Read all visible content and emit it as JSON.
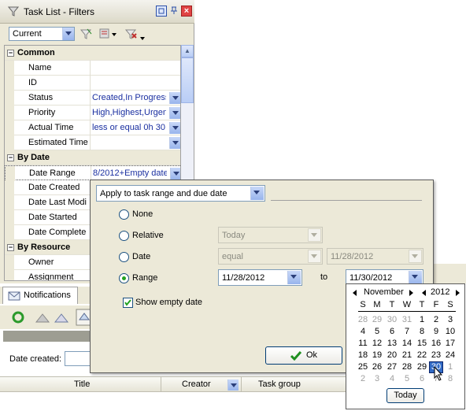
{
  "window": {
    "title": "Task List - Filters"
  },
  "toolbar": {
    "combo_value": "Current"
  },
  "grid": {
    "common": {
      "label": "Common"
    },
    "rows_common": [
      {
        "name": "Name",
        "value": ""
      },
      {
        "name": "ID",
        "value": ""
      },
      {
        "name": "Status",
        "value": "Created,In Progress"
      },
      {
        "name": "Priority",
        "value": "High,Highest,Urgen"
      },
      {
        "name": "Actual Time",
        "value": "less or equal 0h 30"
      },
      {
        "name": "Estimated Time",
        "value": ""
      }
    ],
    "by_date": {
      "label": "By Date"
    },
    "rows_date": [
      {
        "name": "Date Range",
        "value": "8/2012+Empty date"
      },
      {
        "name": "Date Created",
        "value": ""
      },
      {
        "name": "Date Last Modi",
        "value": ""
      },
      {
        "name": "Date Started",
        "value": ""
      },
      {
        "name": "Date Complete",
        "value": ""
      }
    ],
    "by_resource": {
      "label": "By Resource"
    },
    "rows_resource": [
      {
        "name": "Owner",
        "value": ""
      },
      {
        "name": "Assignment",
        "value": ""
      }
    ]
  },
  "notifications": {
    "tab_label": "Notifications"
  },
  "bottom": {
    "date_created_label": "Date created:",
    "columns": [
      "Title",
      "Creator",
      "Task group"
    ]
  },
  "popup": {
    "apply_select": "Apply to task range and due date",
    "options": {
      "none": "None",
      "relative": "Relative",
      "date": "Date",
      "range": "Range"
    },
    "selected_option": "range",
    "relative_value": "Today",
    "date_operator": "equal",
    "date_value": "11/28/2012",
    "range_from": "11/28/2012",
    "range_to_label": "to",
    "range_to": "11/30/2012",
    "show_empty_label": "Show empty date",
    "show_empty_checked": true,
    "ok_label": "Ok"
  },
  "calendar": {
    "month": "November",
    "year": "2012",
    "weekdays": [
      "S",
      "M",
      "T",
      "W",
      "T",
      "F",
      "S"
    ],
    "weeks": [
      [
        "28",
        "29",
        "30",
        "31",
        "1",
        "2",
        "3"
      ],
      [
        "4",
        "5",
        "6",
        "7",
        "8",
        "9",
        "10"
      ],
      [
        "11",
        "12",
        "13",
        "14",
        "15",
        "16",
        "17"
      ],
      [
        "18",
        "19",
        "20",
        "21",
        "22",
        "23",
        "24"
      ],
      [
        "25",
        "26",
        "27",
        "28",
        "29",
        "30",
        "1"
      ],
      [
        "2",
        "3",
        "4",
        "5",
        "6",
        "7",
        "8"
      ]
    ],
    "selected_day": "30",
    "today_label": "Today"
  },
  "colors": {
    "accent": "#316ac5",
    "value_text": "#1a2fa0",
    "panel": "#ece9d8"
  }
}
